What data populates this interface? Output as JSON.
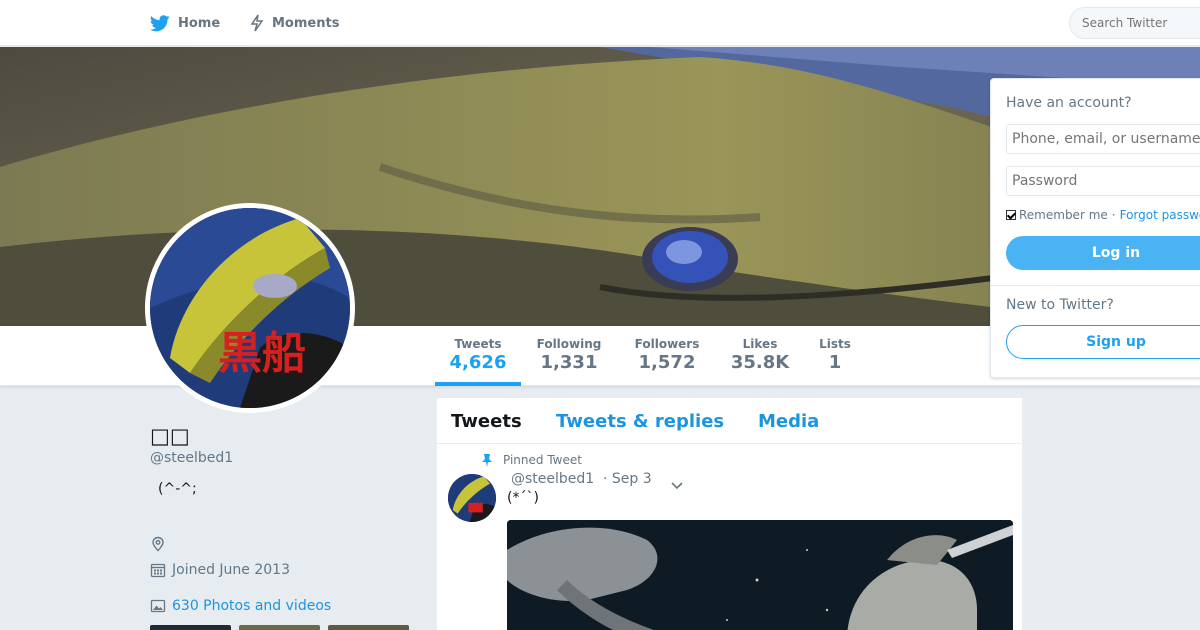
{
  "nav": {
    "home_label": "Home",
    "moments_label": "Moments",
    "search_placeholder": "Search Twitter"
  },
  "colors": {
    "brand_blue": "#1da1f2",
    "link_blue": "#1b95e0",
    "page_bg": "#e6ecf0"
  },
  "stats": [
    {
      "label": "Tweets",
      "value": "4,626",
      "active": true
    },
    {
      "label": "Following",
      "value": "1,331"
    },
    {
      "label": "Followers",
      "value": "1,572"
    },
    {
      "label": "Likes",
      "value": "35.8K"
    },
    {
      "label": "Lists",
      "value": "1"
    }
  ],
  "avatar": {
    "caption": "黒船"
  },
  "profile": {
    "name": "□□",
    "handle": "@steelbed1",
    "bio": "(^-^;",
    "joined": "Joined June 2013",
    "photos_link": "630 Photos and videos",
    "location_icon": "location-icon",
    "calendar_icon": "calendar-icon",
    "photo_icon": "photo-icon"
  },
  "timeline": {
    "tabs": [
      "Tweets",
      "Tweets & replies",
      "Media"
    ],
    "pinned_label": "Pinned Tweet",
    "tweet": {
      "handle": "@steelbed1",
      "date": "· Sep 3",
      "text": "(*´`)"
    }
  },
  "login": {
    "title": "Have an account?",
    "username_placeholder": "Phone, email, or username",
    "password_placeholder": "Password",
    "remember_label": "Remember me",
    "separator": "·",
    "forgot_label": "Forgot password?",
    "login_button": "Log in",
    "new_label": "New to Twitter?",
    "signup_button": "Sign up"
  }
}
